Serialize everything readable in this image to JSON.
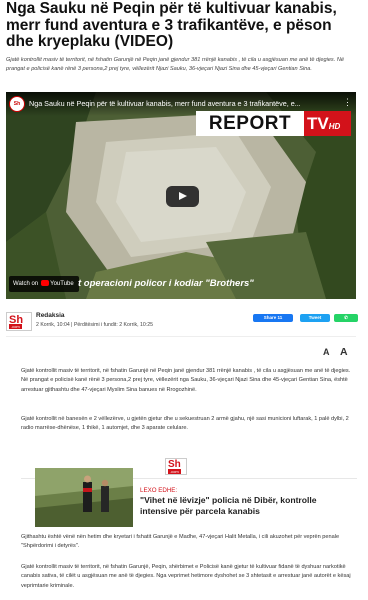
{
  "article": {
    "title": "Nga Sauku në Peqin për të kultivuar kanabis, merr fund aventura e 3 trafikantëve, e pëson dhe kryeplaku (VIDEO)",
    "lead": "Gjatë kontrollit masiv të territorit, në fshatin Garunjë në Peqin janë gjendur 381 rrënjë kanabis , të cila u asgjësuan me anë të djegies. Në prangat e policisë kanë rënë 3 persona,2 prej tyre, vëllezërit Njazi Sauku, 36-vjeçari Njazi Sina dhe 45-vjeçari Gentian Sina."
  },
  "video": {
    "title": "Nga Sauku në Peqin për të kultivuar kanabis, merr fund aventura e 3 trafikantëve, e...",
    "channel_avatar": "Sh",
    "brand_report": "REPORT",
    "brand_tv": "TV",
    "brand_hd": "HD",
    "watch_on": "Watch on",
    "youtube": "YouTube",
    "ticker": "t operacioni policor i kodiar \"Brothers\""
  },
  "meta": {
    "logo": "Sh",
    "logo_sub": ".com",
    "author": "Redaksia",
    "dates": "2 Korrik, 10:04 | Përditësimi i fundit: 2 Korrik, 10:25"
  },
  "share": {
    "facebook": "Share 11",
    "twitter": "Tweet",
    "whatsapp": "✆"
  },
  "font_controls": {
    "decrease": "A",
    "increase": "A"
  },
  "body": {
    "p1": "Gjatë kontrollit masiv të territorit, në fshatin Garunjë në Peqin janë gjendur 381 rrënjë kanabis , të cila u asgjësuan me anë të djegies. Në prangat e policisë kanë rënë 3 persona,2 prej tyre, vëllezërit nga Sauku, 36-vjeçari Njazi Sina dhe 45-vjeçari Gentian Sina, është arrestuar gjithashtu dhe 47-vjeçari Myslim Sina banues në Rrogozhinë.",
    "p2": "Gjatë kontrollit në banesën e 2 vëllezërve, u gjetën gjetur dhe u sekuestruan 2 armë gjahu, një sasi municioni luftarak, 1 palë dylbi, 2 radio marrëse-dhënëse, 1 thikë, 1 automjet, dhe 3 aparate celulare.",
    "p4": "Gjithashtu është vënë nën hetim dhe kryetari i fshatit Garunjë e Madhe, 47-vjeçari Halit Metalla, i cili akuzohet për veprën penale \"Shpërdorimi i detyrës\".",
    "p5": "Gjatë kontrollit masiv të territorit, në fshatin Garunjë, Peqin, shërbimet e Policisë kanë gjetur të kultivuar fidanë të dyshuar narkotikë canabis sativa, të cilët u asgjësuan me anë të djegies. Nga veprimet hetimore dyshohet se 3 shtetasit e arrestuar janë autorët e kësaj veprimtarie kriminale."
  },
  "related": {
    "badge": "Sh",
    "badge_sub": ".com",
    "label": "LEXO EDHE:",
    "title": "\"Vihet në lëvizje\" policia në Dibër, kontrolle intensive për parcela kanabis"
  },
  "colors": {
    "accent": "#d3121a",
    "facebook": "#1877f2",
    "twitter": "#1da1f2",
    "whatsapp": "#25d366"
  }
}
